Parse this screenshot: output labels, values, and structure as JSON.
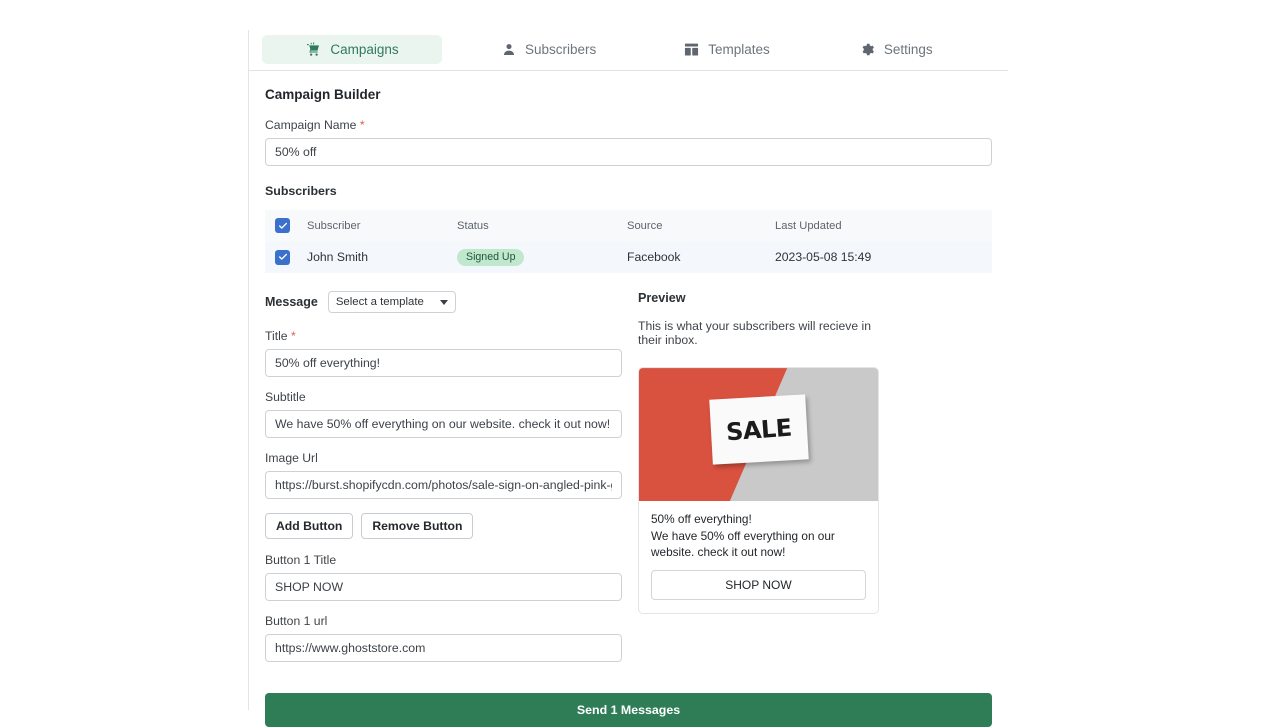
{
  "nav": {
    "tabs": [
      {
        "label": "Campaigns",
        "icon": "campaign-cart-icon",
        "active": true
      },
      {
        "label": "Subscribers",
        "icon": "person-icon",
        "active": false
      },
      {
        "label": "Templates",
        "icon": "layout-icon",
        "active": false
      },
      {
        "label": "Settings",
        "icon": "gear-icon",
        "active": false
      }
    ]
  },
  "page": {
    "title": "Campaign Builder"
  },
  "campaign_name": {
    "label": "Campaign Name",
    "required_marker": "*",
    "value": "50% off"
  },
  "subscribers": {
    "label": "Subscribers",
    "columns": [
      "Subscriber",
      "Status",
      "Source",
      "Last Updated"
    ],
    "select_all_checked": true,
    "rows": [
      {
        "checked": true,
        "subscriber": "John Smith",
        "status": "Signed Up",
        "source": "Facebook",
        "last_updated": "2023-05-08 15:49"
      }
    ]
  },
  "message": {
    "label": "Message",
    "template_select": {
      "value": "Select a template",
      "icon": "chevron-down-icon"
    },
    "title": {
      "label": "Title",
      "required_marker": "*",
      "value": "50% off everything!"
    },
    "subtitle": {
      "label": "Subtitle",
      "value": "We have 50% off everything on our website. check it out now!"
    },
    "image_url": {
      "label": "Image Url",
      "value": "https://burst.shopifycdn.com/photos/sale-sign-on-angled-pink-gray"
    },
    "add_button_label": "Add Button",
    "remove_button_label": "Remove Button",
    "button1_title": {
      "label": "Button 1 Title",
      "value": "SHOP NOW"
    },
    "button1_url": {
      "label": "Button 1 url",
      "value": "https://www.ghoststore.com"
    }
  },
  "preview": {
    "title": "Preview",
    "description": "This is what your subscribers will recieve in their inbox.",
    "image_alt_text": "SALE",
    "headline": "50% off everything!",
    "subtext": "We have 50% off everything on our website. check it out now!",
    "cta_label": "SHOP NOW"
  },
  "send": {
    "label": "Send 1 Messages"
  },
  "colors": {
    "accent_green": "#2f7d56",
    "tab_active_bg": "#eaf5ef",
    "tab_active_text": "#2e7b5d",
    "checkbox_blue": "#3b71ca",
    "badge_bg": "#bfe8ce",
    "badge_text": "#24543a",
    "required_red": "#e05c4a",
    "row_bg": "#f4f7fc",
    "header_bg": "#f8f9fa",
    "preview_image_red": "#d9513f",
    "preview_image_gray": "#c9c9c9"
  }
}
